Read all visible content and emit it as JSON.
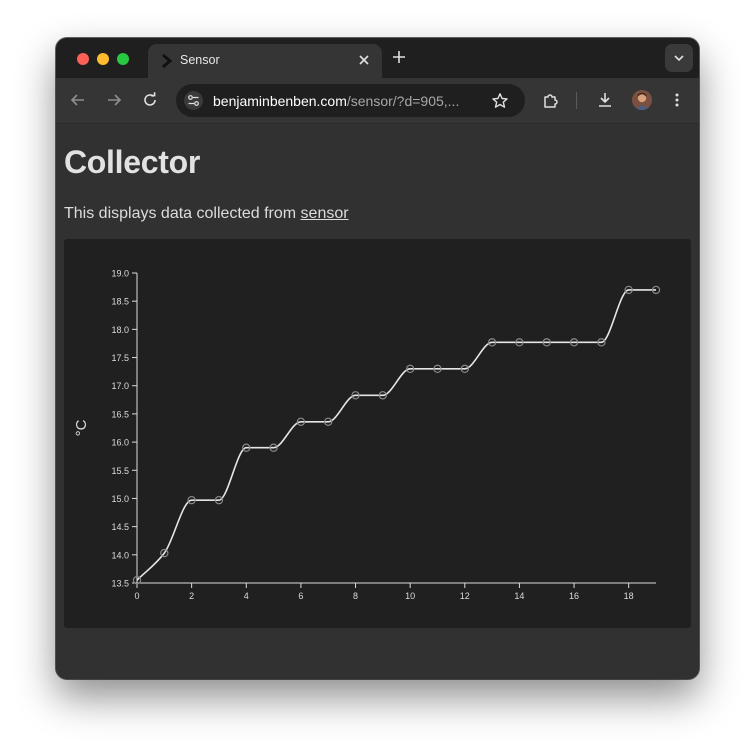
{
  "browser": {
    "tab_title": "Sensor",
    "url_host": "benjaminbenben.com",
    "url_path": "/sensor/?d=905,..."
  },
  "icons": {
    "tab_favicon": "chevron-right-icon",
    "tab_close": "close-icon",
    "new_tab": "plus-icon",
    "tab_search": "chevron-down-icon",
    "back": "arrow-left-icon",
    "forward": "arrow-right-icon",
    "reload": "reload-icon",
    "site_info": "tune-icon",
    "bookmark": "star-icon",
    "extensions": "puzzle-icon",
    "downloads": "download-icon",
    "profile": "avatar-icon",
    "menu": "kebab-menu-icon"
  },
  "page": {
    "title": "Collector",
    "intro_text": "This displays data collected from ",
    "intro_link": "sensor"
  },
  "colors": {
    "line": "#e6e6e6",
    "points": "#8a8a8a",
    "axis": "#dcdcdc",
    "panel": "#202020"
  },
  "chart_data": {
    "type": "line",
    "x": [
      0,
      1,
      2,
      3,
      4,
      5,
      6,
      7,
      8,
      9,
      10,
      11,
      12,
      13,
      14,
      15,
      16,
      17,
      18,
      19
    ],
    "series": [
      {
        "values": [
          13.55,
          14.03,
          14.97,
          14.97,
          15.9,
          15.9,
          16.36,
          16.36,
          16.83,
          16.83,
          17.3,
          17.3,
          17.3,
          17.77,
          17.77,
          17.77,
          17.77,
          17.77,
          18.7,
          18.7
        ]
      }
    ],
    "xlim": [
      0,
      19
    ],
    "ylim": [
      13.5,
      19.0
    ],
    "xticks": [
      0,
      2,
      4,
      6,
      8,
      10,
      12,
      14,
      16,
      18
    ],
    "yticks": [
      "13.5",
      "14.0",
      "14.5",
      "15.0",
      "15.5",
      "16.0",
      "16.5",
      "17.0",
      "17.5",
      "18.0",
      "18.5",
      "19.0"
    ],
    "ylabel": "°C",
    "xlabel": "",
    "title": "",
    "grid": false,
    "curve": "smooth"
  }
}
